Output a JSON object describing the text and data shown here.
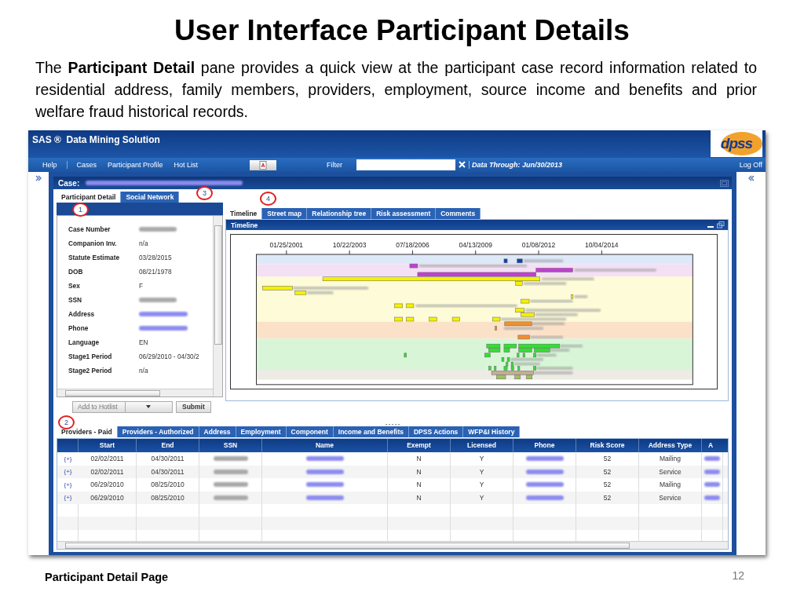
{
  "slide": {
    "title": "User Interface Participant Details",
    "paragraph": "The **Participant Detail** pane provides a quick view at the participant case record information related to residential address, family members, providers, employment, source income and benefits and prior welfare fraud historical records.",
    "footer": "Participant Detail Page",
    "page_number": "12"
  },
  "app": {
    "title": "SAS ®  Data Mining Solution",
    "logo": "dpss",
    "menu": [
      {
        "label": "Help",
        "separator_after": true
      },
      {
        "label": "Cases",
        "separator_after": false
      },
      {
        "label": "Participant Profile",
        "separator_after": false
      },
      {
        "label": "Hot List",
        "separator_after": false
      }
    ],
    "filter_label": "Filter",
    "data_through": "Data Through: Jun/30/2013",
    "logoff": "Log Off"
  },
  "case": {
    "label": "Case:"
  },
  "main_tabs": {
    "callout": "3",
    "tabs": [
      {
        "label": "Participant Detail",
        "selected": true
      },
      {
        "label": "Social Network",
        "selected": false
      }
    ]
  },
  "details": {
    "callout": "1",
    "fields": [
      {
        "label": "Case Number",
        "kind": "blurred"
      },
      {
        "label": "Companion Inv.",
        "kind": "text",
        "value": "n/a"
      },
      {
        "label": "Statute Estimate",
        "kind": "text",
        "value": "03/28/2015"
      },
      {
        "label": "DOB",
        "kind": "text",
        "value": "08/21/1978"
      },
      {
        "label": "Sex",
        "kind": "text",
        "value": "F"
      },
      {
        "label": "SSN",
        "kind": "blurred"
      },
      {
        "label": "Address",
        "kind": "blurred-link"
      },
      {
        "label": "Phone",
        "kind": "blurred-link"
      },
      {
        "label": "Language",
        "kind": "text",
        "value": "EN"
      },
      {
        "label": "Stage1 Period",
        "kind": "text",
        "value": "06/29/2010 - 04/30/2"
      },
      {
        "label": "Stage2 Period",
        "kind": "text",
        "value": "n/a"
      }
    ],
    "hotlist": {
      "value": "Add to Hotlist"
    },
    "submit": "Submit"
  },
  "view_tabs": {
    "callout": "4",
    "tabs": [
      {
        "label": "Timeline",
        "selected": true
      },
      {
        "label": "Street map",
        "selected": false
      },
      {
        "label": "Relationship tree",
        "selected": false
      },
      {
        "label": "Risk assessment",
        "selected": false
      },
      {
        "label": "Comments",
        "selected": false
      }
    ]
  },
  "timeline": {
    "title": "Timeline",
    "ticks": [
      "01/25/2001",
      "10/22/2003",
      "07/18/2006",
      "04/13/2009",
      "01/08/2012",
      "10/04/2014"
    ]
  },
  "lower_tabs": {
    "callout": "2",
    "tabs": [
      {
        "label": "Providers - Paid",
        "selected": true
      },
      {
        "label": "Providers - Authorized",
        "selected": false
      },
      {
        "label": "Address",
        "selected": false
      },
      {
        "label": "Employment",
        "selected": false
      },
      {
        "label": "Component",
        "selected": false
      },
      {
        "label": "Income and Benefits",
        "selected": false
      },
      {
        "label": "DPSS Actions",
        "selected": false
      },
      {
        "label": "WFP&I History",
        "selected": false
      }
    ]
  },
  "table": {
    "columns": [
      "Start",
      "End",
      "SSN",
      "Name",
      "Exempt",
      "Licensed",
      "Phone",
      "Risk Score",
      "Address Type",
      "A"
    ],
    "rows": [
      {
        "expander": "{+}",
        "cells": [
          {
            "kind": "text",
            "text": "02/02/2011"
          },
          {
            "kind": "text",
            "text": "04/30/2011"
          },
          {
            "kind": "blurred"
          },
          {
            "kind": "blurred-link"
          },
          {
            "kind": "text",
            "text": "N"
          },
          {
            "kind": "text",
            "text": "Y"
          },
          {
            "kind": "blurred-link"
          },
          {
            "kind": "text",
            "text": "52"
          },
          {
            "kind": "text",
            "text": "Mailing"
          },
          {
            "kind": "blurred-link"
          }
        ]
      },
      {
        "expander": "{+}",
        "cells": [
          {
            "kind": "text",
            "text": "02/02/2011"
          },
          {
            "kind": "text",
            "text": "04/30/2011"
          },
          {
            "kind": "blurred"
          },
          {
            "kind": "blurred-link"
          },
          {
            "kind": "text",
            "text": "N"
          },
          {
            "kind": "text",
            "text": "Y"
          },
          {
            "kind": "blurred-link"
          },
          {
            "kind": "text",
            "text": "52"
          },
          {
            "kind": "text",
            "text": "Service"
          },
          {
            "kind": "blurred-link"
          }
        ]
      },
      {
        "expander": "{+}",
        "cells": [
          {
            "kind": "text",
            "text": "06/29/2010"
          },
          {
            "kind": "text",
            "text": "08/25/2010"
          },
          {
            "kind": "blurred"
          },
          {
            "kind": "blurred-link"
          },
          {
            "kind": "text",
            "text": "N"
          },
          {
            "kind": "text",
            "text": "Y"
          },
          {
            "kind": "blurred-link"
          },
          {
            "kind": "text",
            "text": "52"
          },
          {
            "kind": "text",
            "text": "Mailing"
          },
          {
            "kind": "blurred-link"
          }
        ]
      },
      {
        "expander": "{+}",
        "cells": [
          {
            "kind": "text",
            "text": "06/29/2010"
          },
          {
            "kind": "text",
            "text": "08/25/2010"
          },
          {
            "kind": "blurred"
          },
          {
            "kind": "blurred-link"
          },
          {
            "kind": "text",
            "text": "N"
          },
          {
            "kind": "text",
            "text": "Y"
          },
          {
            "kind": "blurred-link"
          },
          {
            "kind": "text",
            "text": "52"
          },
          {
            "kind": "text",
            "text": "Service"
          },
          {
            "kind": "blurred-link"
          }
        ]
      }
    ]
  }
}
